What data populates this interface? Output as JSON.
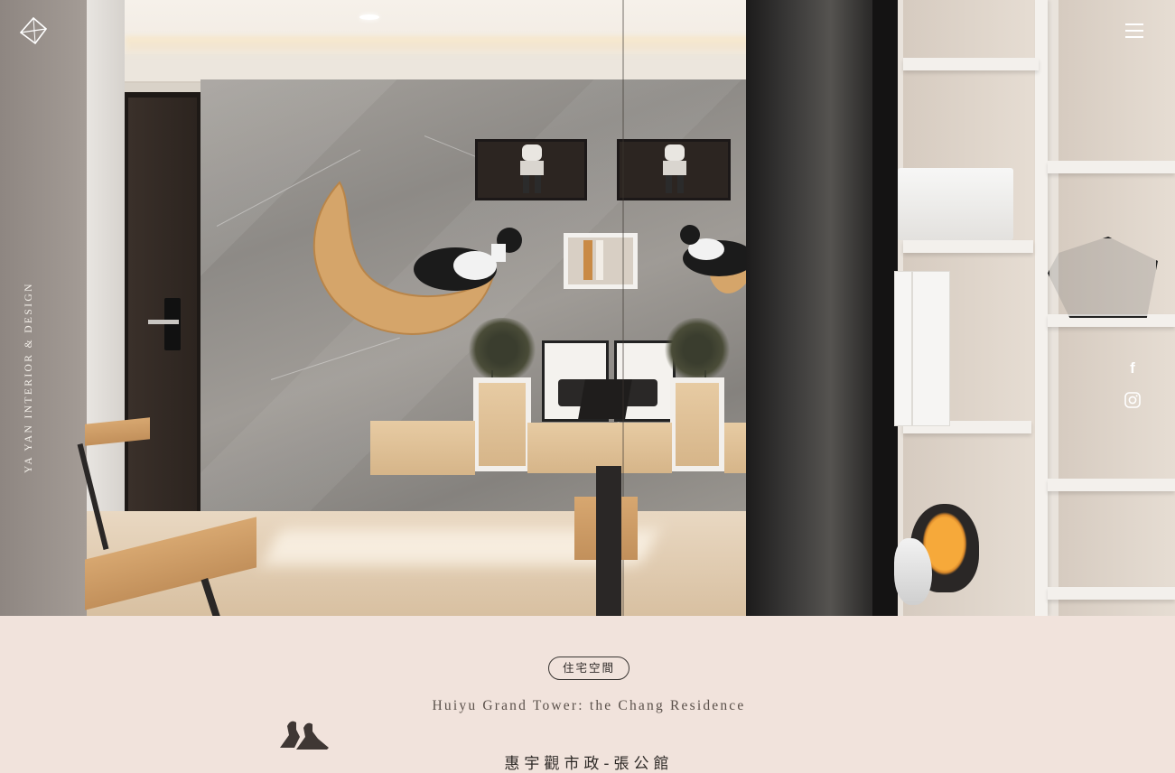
{
  "brand": {
    "name_vertical": "YA YAN INTERIOR & DESIGN",
    "logo_icon": "diamond-logo-icon"
  },
  "header": {
    "menu_icon": "hamburger-menu-icon"
  },
  "social": {
    "facebook_label": "f",
    "facebook_icon": "facebook-icon",
    "instagram_icon": "instagram-icon"
  },
  "hero": {
    "image_description_icon": "hero-photo"
  },
  "project": {
    "category": "住宅空間",
    "title_en": "Huiyu Grand Tower: the Chang Residence",
    "title_zh": "惠宇觀市政-張公館"
  },
  "colors": {
    "background": "#f1e3dc",
    "text_dark": "#2d2926",
    "text_muted": "#5a504a",
    "overlay_white": "#ffffff"
  }
}
